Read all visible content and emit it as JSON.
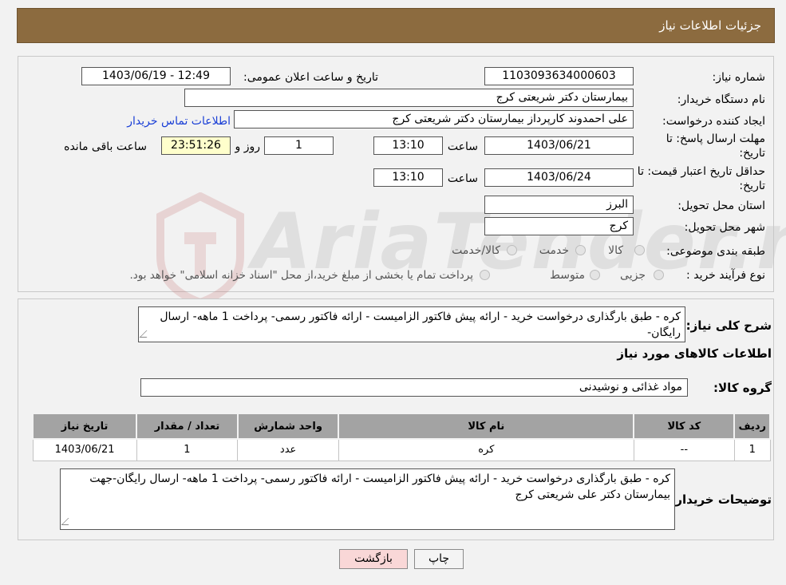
{
  "header": {
    "title": "جزئیات اطلاعات نیاز"
  },
  "form": {
    "need_number_label": "شماره نیاز:",
    "need_number": "1103093634000603",
    "announce_label": "تاریخ و ساعت اعلان عمومی:",
    "announce_value": "1403/06/19 - 12:49",
    "buyer_org_label": "نام دستگاه خریدار:",
    "buyer_org": "بیمارستان دکتر شریعتی کرج",
    "creator_label": "ایجاد کننده درخواست:",
    "creator": "علی احمدوند کارپرداز بیمارستان دکتر شریعتی کرج",
    "contact_link": "اطلاعات تماس خریدار",
    "reply_deadline_label_1": "مهلت ارسال پاسخ: تا",
    "reply_deadline_label_2": "تاریخ:",
    "reply_date": "1403/06/21",
    "time_label": "ساعت",
    "reply_time": "13:10",
    "days_value": "1",
    "days_label": "روز و",
    "remaining_value": "23:51:26",
    "remaining_label": "ساعت باقی مانده",
    "validity_label_1": "حداقل تاریخ اعتبار قیمت: تا",
    "validity_label_2": "تاریخ:",
    "validity_date": "1403/06/24",
    "validity_time": "13:10",
    "province_label": "استان محل تحویل:",
    "province": "البرز",
    "city_label": "شهر محل تحویل:",
    "city": "کرج",
    "category_label": "طبقه بندی موضوعی:",
    "category_options": [
      "کالا",
      "خدمت",
      "کالا/خدمت"
    ],
    "process_label": "نوع فرآیند خرید :",
    "process_options": [
      "جزیی",
      "متوسط"
    ],
    "process_note": "پرداخت تمام یا بخشی از مبلغ خرید،از محل \"اسناد خزانه اسلامی\" خواهد بود."
  },
  "details": {
    "summary_label": "شرح کلی نیاز:",
    "summary_text": "کره - طبق بارگذاری درخواست خرید - ارائه پیش فاکتور الزامیست - ارائه فاکتور رسمی- پرداخت 1 ماهه- ارسال رایگان-",
    "goods_info_title": "اطلاعات کالاهای مورد نیاز",
    "goods_group_label": "گروه کالا:",
    "goods_group": "مواد غذائی و نوشیدنی",
    "table": {
      "headers": [
        "ردیف",
        "کد کالا",
        "نام کالا",
        "واحد شمارش",
        "تعداد / مقدار",
        "تاریخ نیاز"
      ],
      "rows": [
        [
          "1",
          "--",
          "کره",
          "عدد",
          "1",
          "1403/06/21"
        ]
      ]
    },
    "buyer_notes_label": "توضیحات خریدار:",
    "buyer_notes": "کره - طبق بارگذاری درخواست خرید - ارائه پیش فاکتور الزامیست - ارائه فاکتور رسمی- پرداخت 1 ماهه- ارسال رایگان-جهت بیمارستان دکتر علی شریعتی کرج"
  },
  "buttons": {
    "print": "چاپ",
    "back": "بازگشت"
  },
  "watermark": "AriaTender.neT",
  "colors": {
    "header": "#8c6b3f",
    "table_header": "#a3a3a3",
    "link": "#1a3fd6",
    "back_button": "#f9d7d7"
  }
}
